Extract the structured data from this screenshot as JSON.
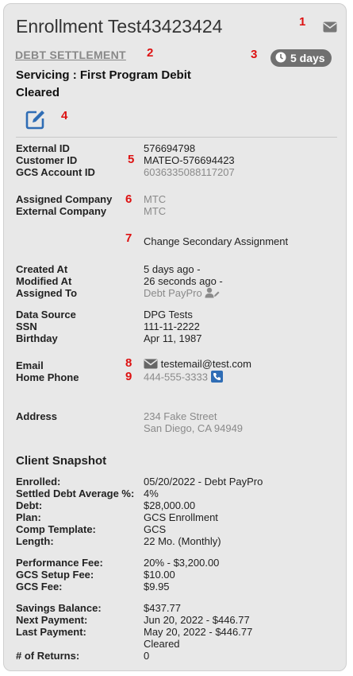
{
  "header": {
    "title": "Enrollment Test43423424",
    "program_link": "DEBT SETTLEMENT",
    "days_badge": "5 days",
    "status": "Servicing : First Program Debit Cleared"
  },
  "annotations": [
    "1",
    "2",
    "3",
    "4",
    "5",
    "6",
    "7",
    "8",
    "9"
  ],
  "ids": {
    "external_id_label": "External ID",
    "external_id": "576694798",
    "customer_id_label": "Customer ID",
    "customer_id": "MATEO-576694423",
    "gcs_account_id_label": "GCS Account ID",
    "gcs_account_id": "6036335088117207"
  },
  "companies": {
    "assigned_label": "Assigned Company",
    "assigned": "MTC",
    "external_label": "External Company",
    "external": "MTC",
    "change_link": "Change Secondary Assignment"
  },
  "dates": {
    "created_label": "Created At",
    "created": "5 days ago -",
    "modified_label": "Modified At",
    "modified": "26 seconds ago -",
    "assigned_to_label": "Assigned To",
    "assigned_to": "Debt PayPro"
  },
  "identity": {
    "data_source_label": "Data Source",
    "data_source": "DPG Tests",
    "ssn_label": "SSN",
    "ssn": "111-11-2222",
    "birthday_label": "Birthday",
    "birthday": "Apr 11, 1987"
  },
  "contact": {
    "email_label": "Email",
    "email": "testemail@test.com",
    "phone_label": "Home Phone",
    "phone": "444-555-3333",
    "address_label": "Address",
    "address_line1": "234 Fake Street",
    "address_line2": "San Diego, CA 94949"
  },
  "snapshot": {
    "title": "Client Snapshot",
    "enrolled_label": "Enrolled:",
    "enrolled": "05/20/2022 - Debt PayPro",
    "settled_label": "Settled Debt Average %:",
    "settled": "4%",
    "debt_label": "Debt:",
    "debt": "$28,000.00",
    "plan_label": "Plan:",
    "plan": "GCS Enrollment",
    "comp_label": "Comp Template:",
    "comp": "GCS",
    "length_label": "Length:",
    "length": "22 Mo. (Monthly)",
    "perf_fee_label": "Performance Fee:",
    "perf_fee": "20% - $3,200.00",
    "setup_fee_label": "GCS Setup Fee:",
    "setup_fee": "$10.00",
    "gcs_fee_label": "GCS Fee:",
    "gcs_fee": "$9.95",
    "savings_label": "Savings Balance:",
    "savings": "$437.77",
    "next_payment_label": "Next Payment:",
    "next_payment": "Jun 20, 2022 - $446.77",
    "last_payment_label": "Last Payment:",
    "last_payment": "May 20, 2022 - $446.77",
    "last_payment_status": "Cleared",
    "returns_label": "# of Returns:",
    "returns": "0"
  },
  "colors": {
    "accent": "#2f6db5",
    "annotation": "#dd1111",
    "muted": "#8a8a8a",
    "badge": "#707070"
  }
}
